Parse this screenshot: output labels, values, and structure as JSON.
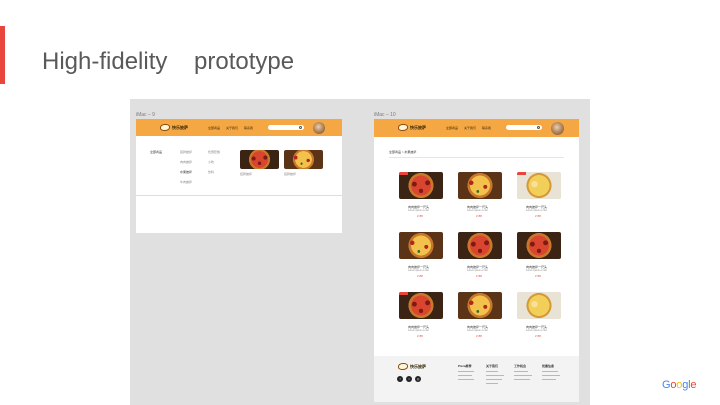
{
  "slide": {
    "title": "High-fidelity    prototype",
    "accent_color": "#e8453c",
    "logo_letters": [
      "G",
      "o",
      "o",
      "g",
      "l",
      "e"
    ],
    "logo_colors": [
      "#4285F4",
      "#EA4335",
      "#FBBC05",
      "#4285F4",
      "#34A853",
      "#EA4335"
    ]
  },
  "frames": {
    "left_label": "iMac – 9",
    "right_label": "iMac – 10",
    "header_color": "#f4a742"
  },
  "header": {
    "brand": "快乐披萨",
    "nav": [
      "全部商品",
      "关于我们",
      "联系我"
    ]
  },
  "left_menu": {
    "category": "全部商品",
    "col1": [
      "招牌披萨",
      "肉肉披萨",
      "水果披萨",
      "牛肉披萨"
    ],
    "col2": [
      "优惠套餐",
      "小吃",
      "饮料"
    ],
    "product_caption": "招牌披萨"
  },
  "right_page": {
    "breadcrumb": "全部商品 > 水果披萨",
    "product_name": "肉肉披萨一尺头",
    "product_sub": "Lorem ipsum et nisi",
    "product_price": "¥ 88",
    "badge_color": "#e8453c",
    "footer_brand": "快乐披萨",
    "footer_cols": [
      "Pizza推荐",
      "关于我们",
      "工作机会",
      "优惠信息"
    ]
  }
}
